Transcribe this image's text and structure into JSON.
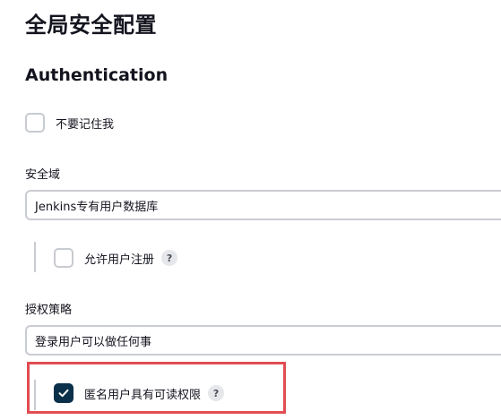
{
  "page_title": "全局安全配置",
  "authentication": {
    "section_title": "Authentication",
    "remember_me_label": "不要记住我",
    "remember_me_checked": false
  },
  "security_realm": {
    "label": "安全域",
    "selected": "Jenkins专有用户数据库",
    "allow_signup_label": "允许用户注册",
    "allow_signup_checked": false,
    "help_glyph": "?"
  },
  "authorization": {
    "label": "授权策略",
    "selected": "登录用户可以做任何事",
    "anonymous_read_label": "匿名用户具有可读权限",
    "anonymous_read_checked": true,
    "help_glyph": "?"
  },
  "colors": {
    "checkbox_checked": "#0b3049",
    "highlight_border": "#e04d52"
  },
  "icons": [
    "check-icon",
    "help-icon"
  ]
}
